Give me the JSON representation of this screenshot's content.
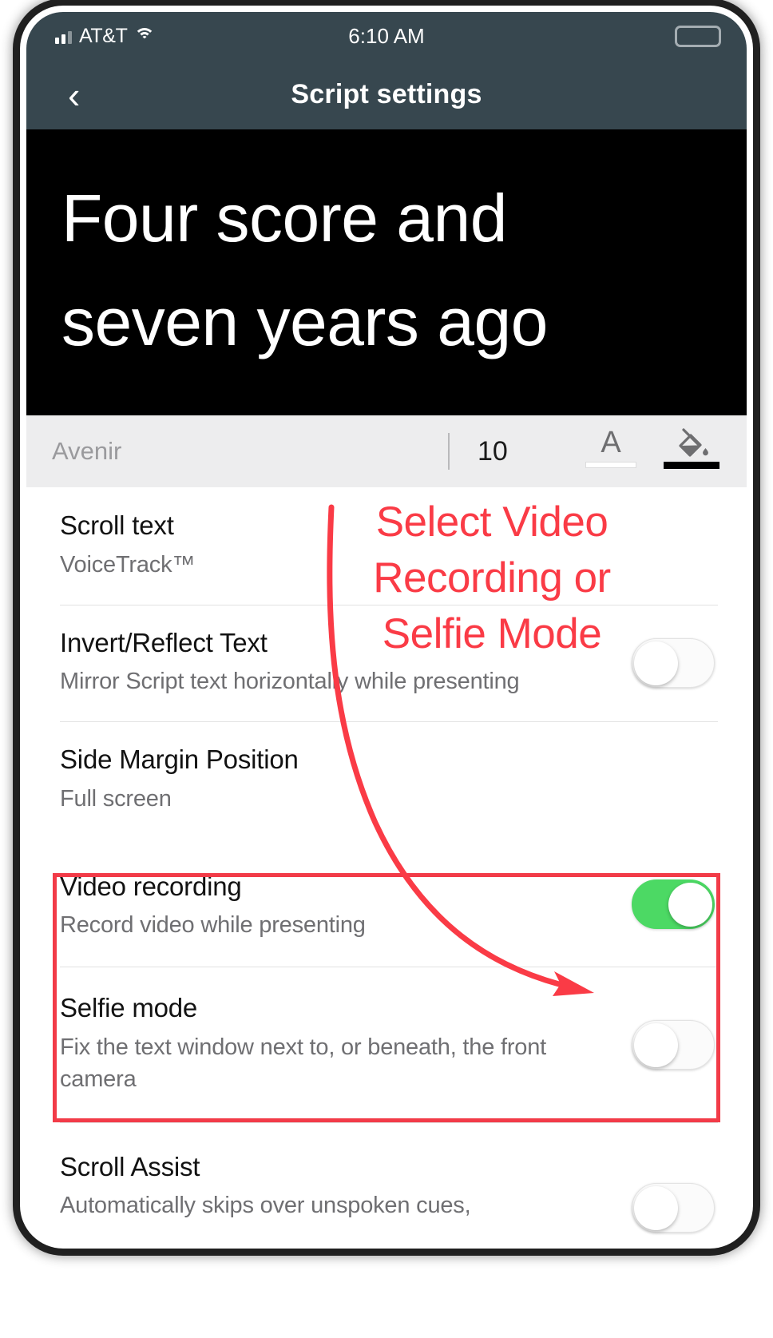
{
  "status_bar": {
    "carrier": "AT&T",
    "time": "6:10 AM",
    "signal_icon": "signal-bars-icon",
    "wifi_icon": "wifi-icon",
    "battery_icon": "battery-icon"
  },
  "nav_bar": {
    "back_icon": "‹",
    "title": "Script settings"
  },
  "script_preview": {
    "line_1": "Four score and",
    "line_2": "seven years ago",
    "text_color": "#ffffff",
    "background_color": "#000000"
  },
  "font_toolbar": {
    "font_name": "Avenir",
    "font_size": "10",
    "text_color_glyph": "A",
    "text_color_swatch": "#ffffff",
    "bg_color_swatch": "#000000"
  },
  "settings": [
    {
      "title": "Scroll text",
      "subtitle": "VoiceTrack™",
      "toggle": null
    },
    {
      "title": "Invert/Reflect Text",
      "subtitle": "Mirror Script text horizontally while presenting",
      "toggle": "off"
    },
    {
      "title": "Side Margin Position",
      "subtitle": "Full screen",
      "toggle": null
    },
    {
      "title": "Video recording",
      "subtitle": "Record video while presenting",
      "toggle": "on"
    },
    {
      "title": "Selfie mode",
      "subtitle": "Fix the text window next to, or beneath, the front camera",
      "toggle": "off"
    },
    {
      "title": "Scroll Assist",
      "subtitle": "Automatically skips over unspoken cues,",
      "toggle": "off"
    }
  ],
  "annotation": {
    "text": "Select Video Recording or Selfie Mode",
    "color": "#fa3b46",
    "highlight_border_color": "#f23b48"
  },
  "colors": {
    "nav_background": "#37474f",
    "toggle_on": "#4cd964",
    "toolbar_background": "#ededee",
    "subtitle_text": "#6f6f72"
  }
}
